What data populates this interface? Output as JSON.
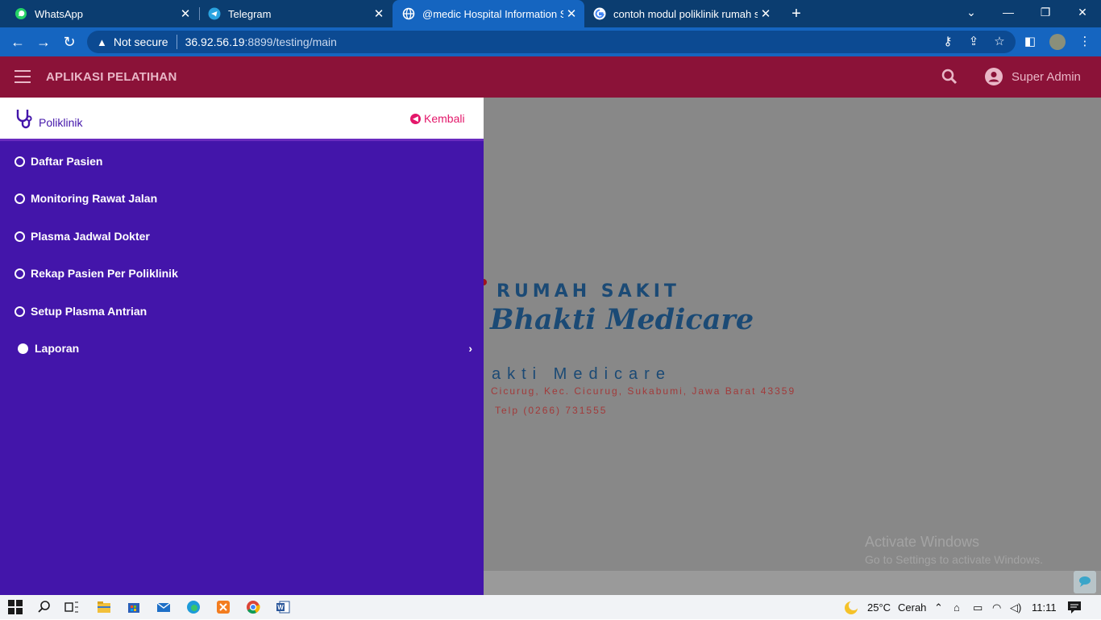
{
  "browser": {
    "tabs": [
      {
        "title": "WhatsApp",
        "icon": "whatsapp-icon"
      },
      {
        "title": "Telegram",
        "icon": "telegram-icon"
      },
      {
        "title": "@medic Hospital Information Sys",
        "icon": "globe-icon"
      },
      {
        "title": "contoh modul poliklinik rumah sa",
        "icon": "google-icon"
      }
    ],
    "active_tab": 2,
    "security_label": "Not secure",
    "url_host": "36.92.56.19",
    "url_path": ":8899/testing/main"
  },
  "app": {
    "title": "APLIKASI PELATIHAN",
    "user": "Super Admin"
  },
  "sidebar": {
    "title": "Poliklinik",
    "back_label": "Kembali",
    "items": [
      {
        "label": "Daftar Pasien"
      },
      {
        "label": "Monitoring Rawat Jalan"
      },
      {
        "label": "Plasma Jadwal Dokter"
      },
      {
        "label": "Rekap Pasien Per Poliklinik"
      },
      {
        "label": "Setup Plasma Antrian"
      },
      {
        "label": "Laporan"
      }
    ]
  },
  "content": {
    "logo_line1": "RUMAH SAKIT",
    "logo_line2": "Bhakti Medicare",
    "name_spaced": "akti Medicare",
    "address": "Cicurug, Kec. Cicurug, Sukabumi, Jawa Barat 43359",
    "phone": "Telp (0266) 731555"
  },
  "watermark": {
    "line1": "Activate Windows",
    "line2": "Go to Settings to activate Windows."
  },
  "taskbar": {
    "weather": "25°C",
    "weather_desc": "Cerah",
    "time": "11:11"
  },
  "colors": {
    "app_header": "#8b1238",
    "sidebar": "#4315aa",
    "accent_back": "#e3176a",
    "browser_chrome": "#0b3d70"
  }
}
